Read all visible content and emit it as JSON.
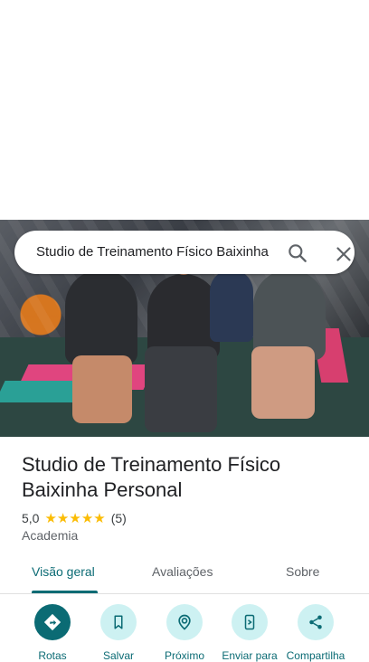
{
  "search": {
    "query": "Studio de Treinamento Físico Baixinha Personal"
  },
  "place": {
    "name": "Studio de Treinamento Físico Baixinha Personal",
    "rating": "5,0",
    "stars": 5,
    "review_count": "(5)",
    "category": "Academia"
  },
  "tabs": [
    {
      "label": "Visão geral",
      "active": true
    },
    {
      "label": "Avaliações",
      "active": false
    },
    {
      "label": "Sobre",
      "active": false
    }
  ],
  "actions": [
    {
      "label": "Rotas",
      "icon": "directions-icon"
    },
    {
      "label": "Salvar",
      "icon": "bookmark-icon"
    },
    {
      "label": "Próximo",
      "icon": "nearby-icon"
    },
    {
      "label": "Enviar para",
      "icon": "send-to-phone-icon"
    },
    {
      "label": "Compartilha",
      "icon": "share-icon"
    }
  ],
  "colors": {
    "accent": "#0b6b74",
    "action_bg": "#cdf1f2",
    "star": "#fbbc04"
  }
}
